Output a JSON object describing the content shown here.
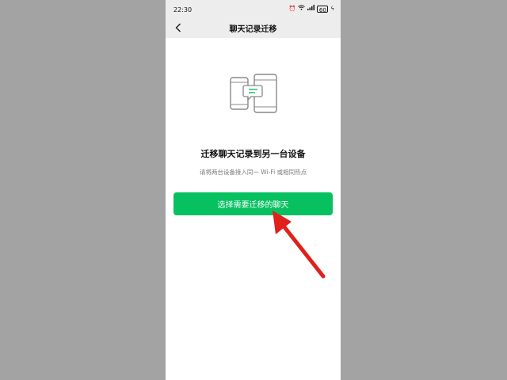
{
  "status_bar": {
    "time": "22:30",
    "icons": [
      "wifi-icon",
      "signal-icon",
      "battery-icon"
    ],
    "battery_label": "60"
  },
  "nav": {
    "title": "聊天记录迁移"
  },
  "content": {
    "title": "迁移聊天记录到另一台设备",
    "subtitle": "请将两台设备接入同一 Wi-Fi 或相同热点",
    "button_label": "选择需要迁移的聊天"
  },
  "colors": {
    "accent": "#07c160",
    "annotation_arrow": "#e0201b",
    "background": "#a3a3a3"
  }
}
